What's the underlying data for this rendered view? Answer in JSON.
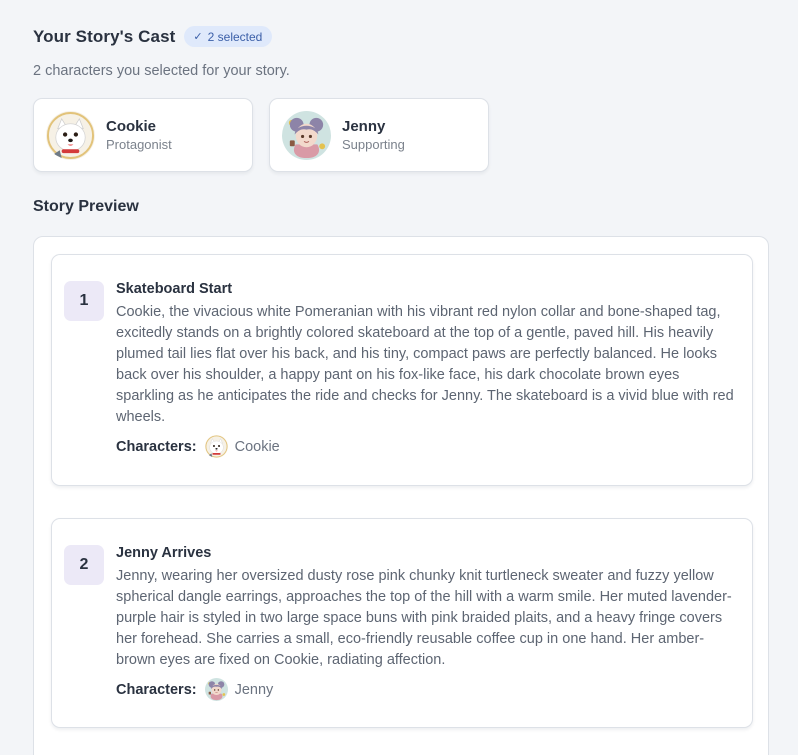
{
  "cast": {
    "title": "Your Story's Cast",
    "badge": "2 selected",
    "subtitle": "2 characters you selected for your story.",
    "characters": [
      {
        "name": "Cookie",
        "role": "Protagonist",
        "avatar_icon": "pomeranian-avatar-icon"
      },
      {
        "name": "Jenny",
        "role": "Supporting",
        "avatar_icon": "girl-avatar-icon"
      }
    ]
  },
  "preview": {
    "title": "Story Preview",
    "characters_label": "Characters:",
    "scenes": [
      {
        "number": "1",
        "title": "Skateboard Start",
        "text": "Cookie, the vivacious white Pomeranian with his vibrant red nylon collar and bone-shaped tag, excitedly stands on a brightly colored skateboard at the top of a gentle, paved hill. His heavily plumed tail lies flat over his back, and his tiny, compact paws are perfectly balanced. He looks back over his shoulder, a happy pant on his fox-like face, his dark chocolate brown eyes sparkling as he anticipates the ride and checks for Jenny. The skateboard is a vivid blue with red wheels.",
        "characters": [
          "Cookie"
        ]
      },
      {
        "number": "2",
        "title": "Jenny Arrives",
        "text": "Jenny, wearing her oversized dusty rose pink chunky knit turtleneck sweater and fuzzy yellow spherical dangle earrings, approaches the top of the hill with a warm smile. Her muted lavender-purple hair is styled in two large space buns with pink braided plaits, and a heavy fringe covers her forehead. She carries a small, eco-friendly reusable coffee cup in one hand. Her amber-brown eyes are fixed on Cookie, radiating affection.",
        "characters": [
          "Jenny"
        ]
      }
    ]
  },
  "colors": {
    "background": "#f3f5f8",
    "badge_bg": "#dfe9fb",
    "badge_text": "#3b5fa8",
    "scene_number_bg": "#ece9f7"
  }
}
